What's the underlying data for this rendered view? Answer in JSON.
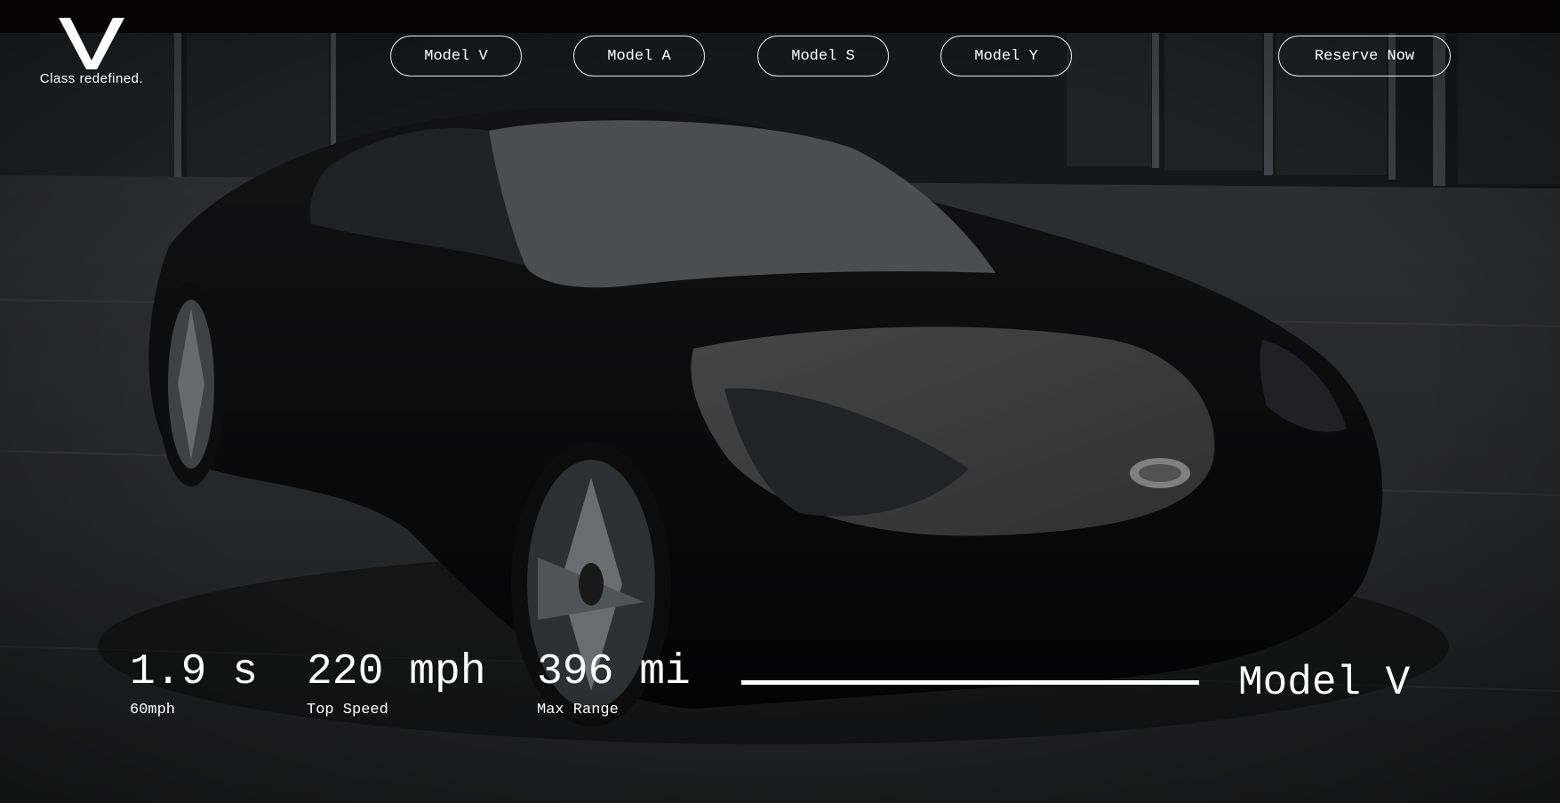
{
  "brand": {
    "logo_letter": "V",
    "tagline": "Class redefined."
  },
  "nav": {
    "items": [
      {
        "label": "Model V"
      },
      {
        "label": "Model A"
      },
      {
        "label": "Model S"
      },
      {
        "label": "Model Y"
      }
    ],
    "cta_label": "Reserve Now"
  },
  "hero": {
    "image": "concept sports car in parking area",
    "stats": [
      {
        "value": "1.9 s",
        "label": "60mph"
      },
      {
        "value": "220 mph",
        "label": "Top Speed"
      },
      {
        "value": "396 mi",
        "label": "Max Range"
      }
    ],
    "model_name": "Model V"
  },
  "colors": {
    "topbar": "#050203",
    "text": "#ffffff",
    "button_border": "#e8e8e8"
  }
}
